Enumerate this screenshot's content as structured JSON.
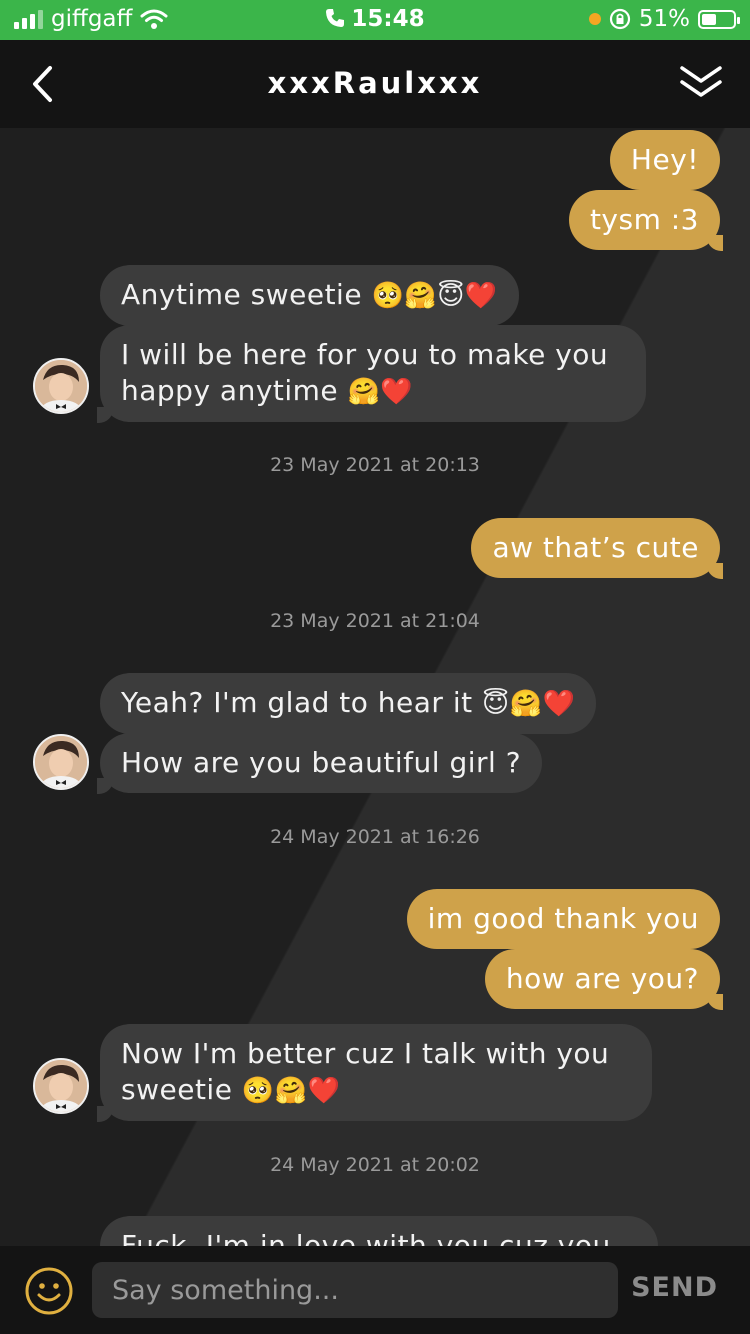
{
  "status_bar": {
    "carrier": "giffgaff",
    "time": "15:48",
    "battery": "51%",
    "battery_level": 0.51
  },
  "header": {
    "title": "xxxRaulxxx",
    "back_icon": "chevron-left-icon",
    "collapse_icon": "double-chevron-down-icon"
  },
  "messages": [
    {
      "dir": "out",
      "text": "Hey!"
    },
    {
      "dir": "out",
      "text": "tysm :3"
    },
    {
      "dir": "in",
      "text": "Anytime sweetie",
      "emojis": "🥺🤗😇❤️"
    },
    {
      "dir": "in",
      "text": "I will be here for you to make you happy anytime",
      "emojis": "🤗❤️"
    },
    {
      "dir": "stamp",
      "text": "23 May 2021 at 20:13"
    },
    {
      "dir": "out",
      "text": "aw that’s cute"
    },
    {
      "dir": "stamp",
      "text": "23 May 2021 at 21:04"
    },
    {
      "dir": "in",
      "text": "Yeah? I'm glad to hear it",
      "emojis": "😇🤗❤️"
    },
    {
      "dir": "in",
      "text": "How are you beautiful girl ?"
    },
    {
      "dir": "stamp",
      "text": "24 May 2021 at 16:26"
    },
    {
      "dir": "out",
      "text": "im good thank you"
    },
    {
      "dir": "out",
      "text": "how are you?"
    },
    {
      "dir": "in",
      "text": "Now I'm better cuz I talk with you sweetie",
      "emojis": "🥺🤗❤️"
    },
    {
      "dir": "stamp",
      "text": "24 May 2021 at 20:02"
    },
    {
      "dir": "in",
      "text": "Fuck, I'm in love with you cuz you"
    }
  ],
  "composer": {
    "placeholder": "Say something...",
    "send_label": "SEND",
    "emoji_icon": "smiley-icon"
  },
  "colors": {
    "outgoing_bubble": "#cfa24a",
    "incoming_bubble": "#3c3c3c",
    "status_bar": "#3bb54a",
    "header": "#141414"
  }
}
